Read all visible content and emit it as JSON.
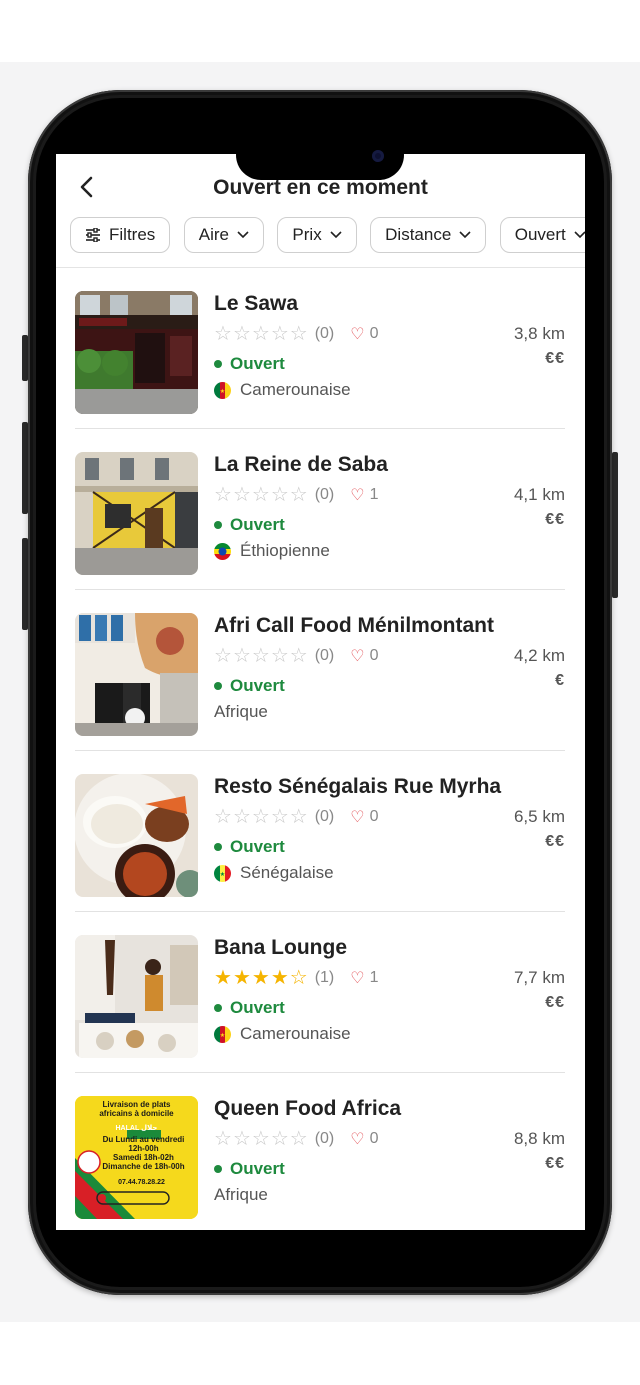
{
  "header": {
    "title": "Ouvert en ce moment",
    "filters": [
      "Filtres",
      "Aire",
      "Prix",
      "Distance",
      "Ouvert"
    ]
  },
  "restaurants": [
    {
      "name": "Le Sawa",
      "rating": 0,
      "reviews": "(0)",
      "likes": "0",
      "status": "Ouvert",
      "cuisine": "Camerounaise",
      "flag": "cameroon-flag-icon",
      "distance": "3,8 km",
      "price": "€€"
    },
    {
      "name": "La Reine de Saba",
      "rating": 0,
      "reviews": "(0)",
      "likes": "1",
      "status": "Ouvert",
      "cuisine": "Éthiopienne",
      "flag": "ethiopia-flag-icon",
      "distance": "4,1 km",
      "price": "€€"
    },
    {
      "name": "Afri Call Food Ménilmontant",
      "rating": 0,
      "reviews": "(0)",
      "likes": "0",
      "status": "Ouvert",
      "cuisine": "Afrique",
      "flag": "",
      "distance": "4,2 km",
      "price": "€"
    },
    {
      "name": "Resto Sénégalais Rue Myrha",
      "rating": 0,
      "reviews": "(0)",
      "likes": "0",
      "status": "Ouvert",
      "cuisine": "Sénégalaise",
      "flag": "senegal-flag-icon",
      "distance": "6,5 km",
      "price": "€€"
    },
    {
      "name": "Bana Lounge",
      "rating": 4,
      "reviews": "(1)",
      "likes": "1",
      "status": "Ouvert",
      "cuisine": "Camerounaise",
      "flag": "cameroon-flag-icon",
      "distance": "7,7 km",
      "price": "€€"
    },
    {
      "name": "Queen Food Africa",
      "rating": 0,
      "reviews": "(0)",
      "likes": "0",
      "status": "Ouvert",
      "cuisine": "Afrique",
      "flag": "",
      "distance": "8,8 km",
      "price": "€€"
    }
  ],
  "flyer": {
    "line1": "Livraison de plats",
    "line2": "africains à domicile",
    "halal": "HALAL حلال",
    "days": "Du Lundi au vendredi",
    "hours1": "12h-00h",
    "sat": "Samedi 18h-02h",
    "sun": "Dimanche de 18h-00h",
    "phone": "07.44.78.28.22"
  },
  "colors": {
    "open": "#1e8a3e",
    "star": "#f5b400",
    "heart": "#e0484e"
  }
}
